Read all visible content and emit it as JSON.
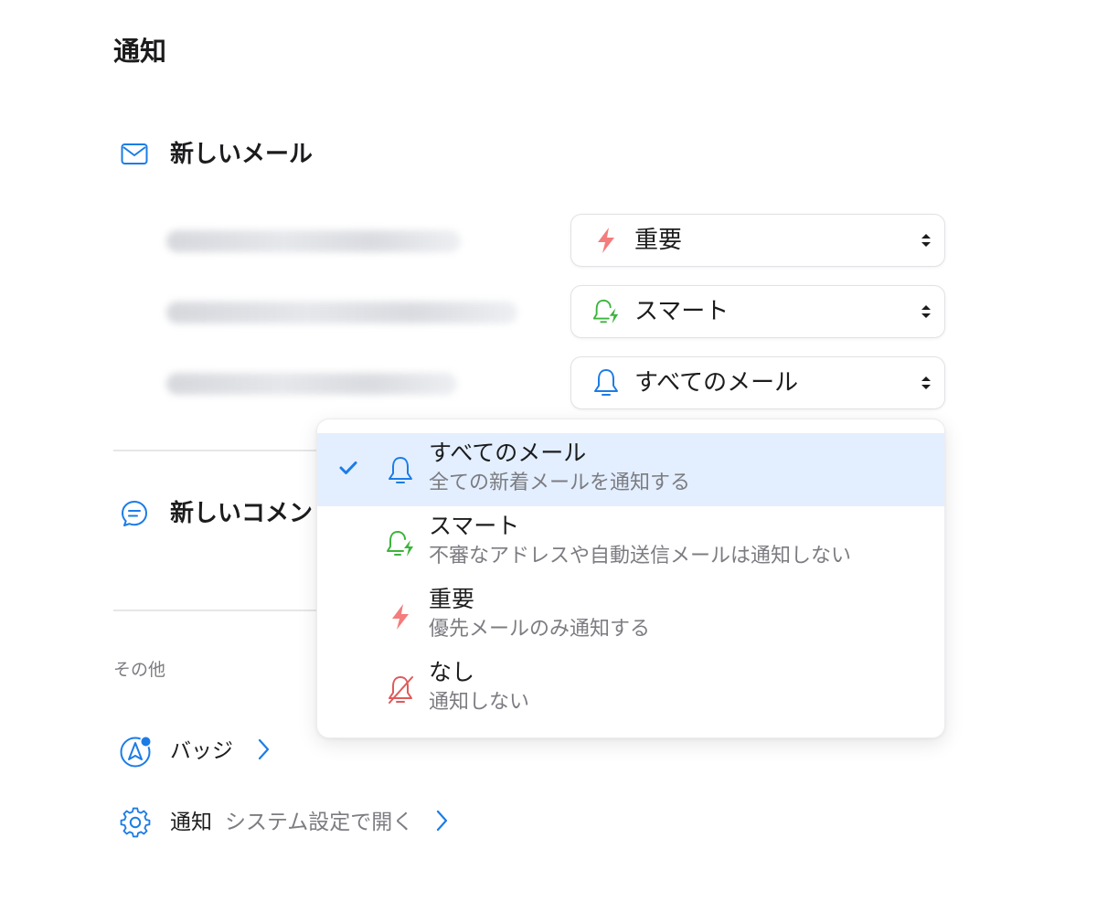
{
  "page": {
    "title": "通知"
  },
  "new_mail": {
    "title": "新しいメール",
    "accounts": [
      {
        "label": "",
        "mode": "重要",
        "mode_icon": "bolt-icon"
      },
      {
        "label": "",
        "mode": "スマート",
        "mode_icon": "smart-bell-icon"
      },
      {
        "label": "",
        "mode": "すべてのメール",
        "mode_icon": "bell-icon"
      }
    ]
  },
  "new_comments": {
    "title": "新しいコメン"
  },
  "dropdown": {
    "options": [
      {
        "title": "すべてのメール",
        "description": "全ての新着メールを通知する",
        "icon": "bell-icon",
        "selected": true
      },
      {
        "title": "スマート",
        "description": "不審なアドレスや自動送信メールは通知しない",
        "icon": "smart-bell-icon",
        "selected": false
      },
      {
        "title": "重要",
        "description": "優先メールのみ通知する",
        "icon": "bolt-icon",
        "selected": false
      },
      {
        "title": "なし",
        "description": "通知しない",
        "icon": "bell-off-icon",
        "selected": false
      }
    ]
  },
  "other": {
    "label": "その他",
    "badge": {
      "label": "バッジ"
    },
    "notifications": {
      "label": "通知",
      "sublabel": "システム設定で開く"
    }
  },
  "colors": {
    "accent_blue": "#1c7ce6",
    "smart_green": "#3cb43c",
    "important_red": "#f47c7c",
    "none_red": "#e05a5a",
    "selected_bg": "#e3efff"
  }
}
